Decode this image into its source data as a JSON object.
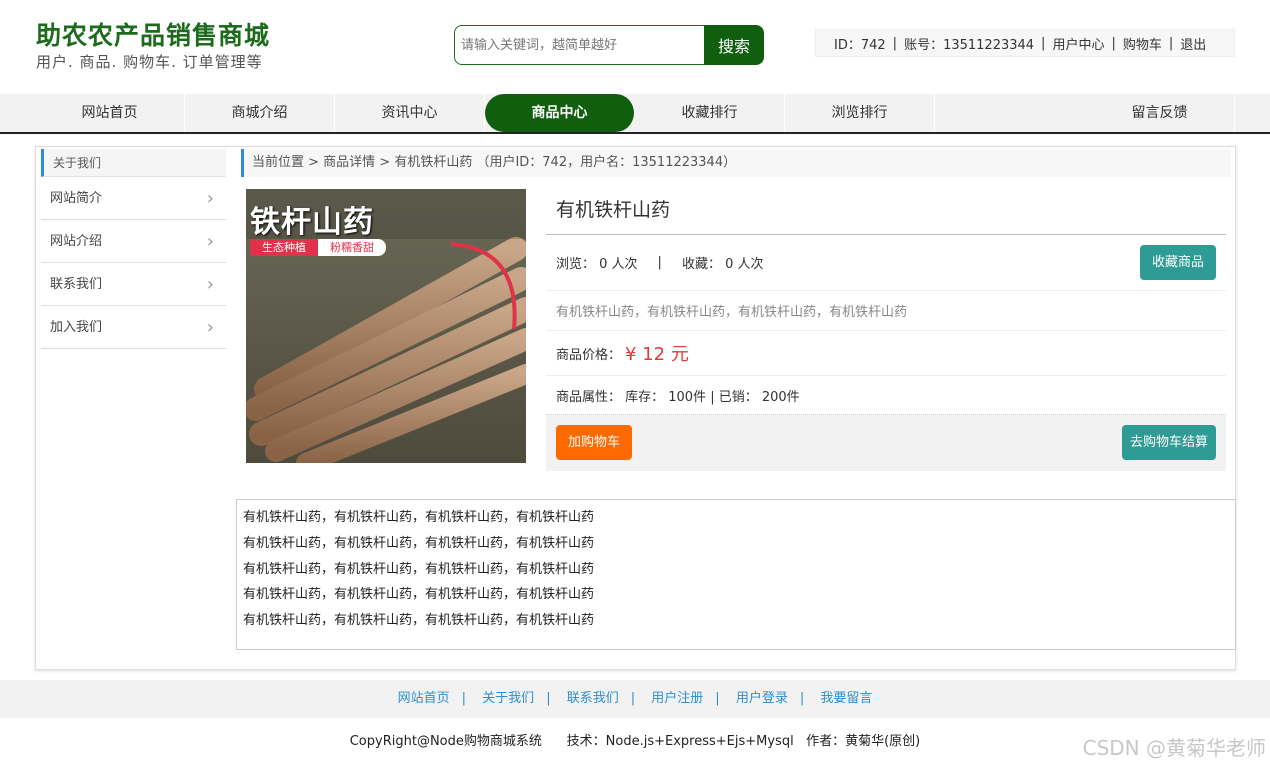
{
  "header": {
    "title": "助农农产品销售商城",
    "subtitle": "用户. 商品. 购物车. 订单管理等",
    "search_placeholder": "请输入关键词，越简单越好",
    "search_button": "搜索"
  },
  "userbar": {
    "id_text": "ID：742",
    "account_text": "账号：13511223344",
    "user_center": "用户中心",
    "cart": "购物车",
    "logout": "退出"
  },
  "nav": {
    "items": [
      "网站首页",
      "商城介绍",
      "资讯中心",
      "商品中心",
      "收藏排行",
      "浏览排行",
      "留言反馈"
    ],
    "active_index": 3
  },
  "sidebar": {
    "title": "关于我们",
    "items": [
      "网站简介",
      "网站介绍",
      "联系我们",
      "加入我们"
    ]
  },
  "breadcrumb": "当前位置 > 商品详情 > 有机铁杆山药  （用户ID：742，用户名：13511223344）",
  "product": {
    "image_text": "铁杆山药",
    "image_tag1": "生态种植",
    "image_tag2": "粉糯香甜",
    "name": "有机铁杆山药",
    "views": "浏览：  0 人次",
    "favorites": "收藏：  0 人次",
    "fav_button": "收藏商品",
    "short_desc": "有机铁杆山药，有机铁杆山药，有机铁杆山药，有机铁杆山药",
    "price_label": "商品价格：",
    "price": "¥ 12 元",
    "attr_text": "商品属性：  库存：  100件 | 已销：  200件",
    "add_cart": "加购物车",
    "checkout": "去购物车结算"
  },
  "detail_lines": [
    "有机铁杆山药，有机铁杆山药，有机铁杆山药，有机铁杆山药",
    "有机铁杆山药，有机铁杆山药，有机铁杆山药，有机铁杆山药",
    "有机铁杆山药，有机铁杆山药，有机铁杆山药，有机铁杆山药",
    "有机铁杆山药，有机铁杆山药，有机铁杆山药，有机铁杆山药",
    "有机铁杆山药，有机铁杆山药，有机铁杆山药，有机铁杆山药"
  ],
  "footer": {
    "links": [
      "网站首页",
      "关于我们",
      "联系我们",
      "用户注册",
      "用户登录",
      "我要留言"
    ],
    "copyright": "CopyRight@Node购物商城系统      技术：Node.js+Express+Ejs+Mysql   作者：黄菊华(原创)",
    "watermark": "CSDN @黄菊华老师"
  },
  "colors": {
    "brand_green": "#0f5f0f",
    "accent_blue": "#2a8fd6",
    "price_red": "#e4393c",
    "cart_orange": "#ff6a00",
    "teal": "#2e9c94"
  }
}
